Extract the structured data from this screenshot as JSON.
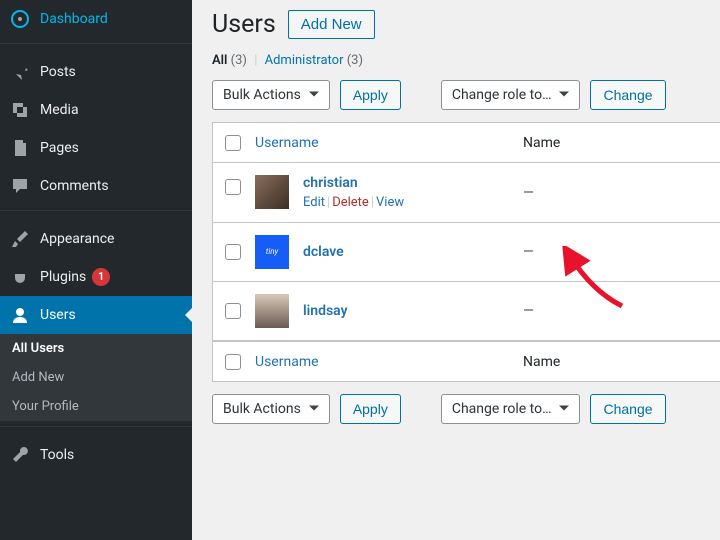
{
  "sidebar": {
    "items": [
      {
        "icon": "dashboard",
        "label": "Dashboard"
      },
      {
        "icon": "posts",
        "label": "Posts"
      },
      {
        "icon": "media",
        "label": "Media"
      },
      {
        "icon": "pages",
        "label": "Pages"
      },
      {
        "icon": "comments",
        "label": "Comments"
      },
      {
        "icon": "appearance",
        "label": "Appearance"
      },
      {
        "icon": "plugins",
        "label": "Plugins",
        "badge": "1"
      },
      {
        "icon": "users",
        "label": "Users",
        "active": true
      },
      {
        "icon": "tools",
        "label": "Tools"
      }
    ],
    "submenu": [
      {
        "label": "All Users",
        "current": true
      },
      {
        "label": "Add New"
      },
      {
        "label": "Your Profile"
      }
    ]
  },
  "page": {
    "title": "Users",
    "add_new": "Add New"
  },
  "filters": {
    "all_label": "All",
    "all_count": "(3)",
    "admin_label": "Administrator",
    "admin_count": "(3)"
  },
  "controls": {
    "bulk": "Bulk Actions",
    "apply": "Apply",
    "change_role": "Change role to…",
    "change": "Change"
  },
  "table": {
    "headers": {
      "username": "Username",
      "name": "Name"
    },
    "rows": [
      {
        "username": "christian",
        "name": "—",
        "actions": {
          "edit": "Edit",
          "delete": "Delete",
          "view": "View"
        }
      },
      {
        "username": "dclave",
        "name": "—"
      },
      {
        "username": "lindsay",
        "name": "—"
      }
    ]
  }
}
